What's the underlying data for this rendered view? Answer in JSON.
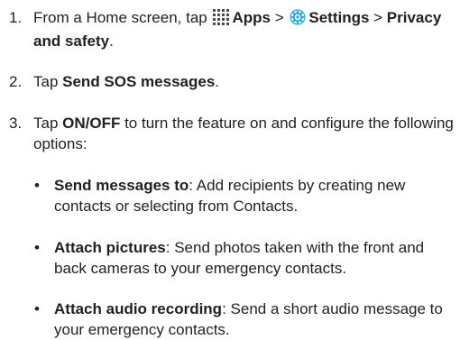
{
  "steps": [
    {
      "number": "1.",
      "pre": "From a Home screen, tap",
      "apps_label": "Apps",
      "sep1": " > ",
      "settings_label": "Settings",
      "sep2": " > ",
      "privacy_label": "Privacy and safety",
      "post": "."
    },
    {
      "number": "2.",
      "pre": "Tap ",
      "bold": "Send SOS messages",
      "post": "."
    },
    {
      "number": "3.",
      "pre": "Tap ",
      "bold": "ON/OFF",
      "post": " to turn the feature on and configure the following options:"
    }
  ],
  "options": [
    {
      "bullet": "•",
      "bold": "Send messages to",
      "text": ": Add recipients by creating new contacts or selecting from Contacts."
    },
    {
      "bullet": "•",
      "bold": "Attach pictures",
      "text": ": Send photos taken with the front and back cameras to your emergency contacts."
    },
    {
      "bullet": "•",
      "bold": "Attach audio recording",
      "text": ": Send a short audio message to your emergency contacts."
    }
  ],
  "icons": {
    "apps": "apps-grid-icon",
    "settings": "settings-gear-icon",
    "apps_color": "#4a4a4a",
    "settings_color": "#2aa9d6"
  }
}
